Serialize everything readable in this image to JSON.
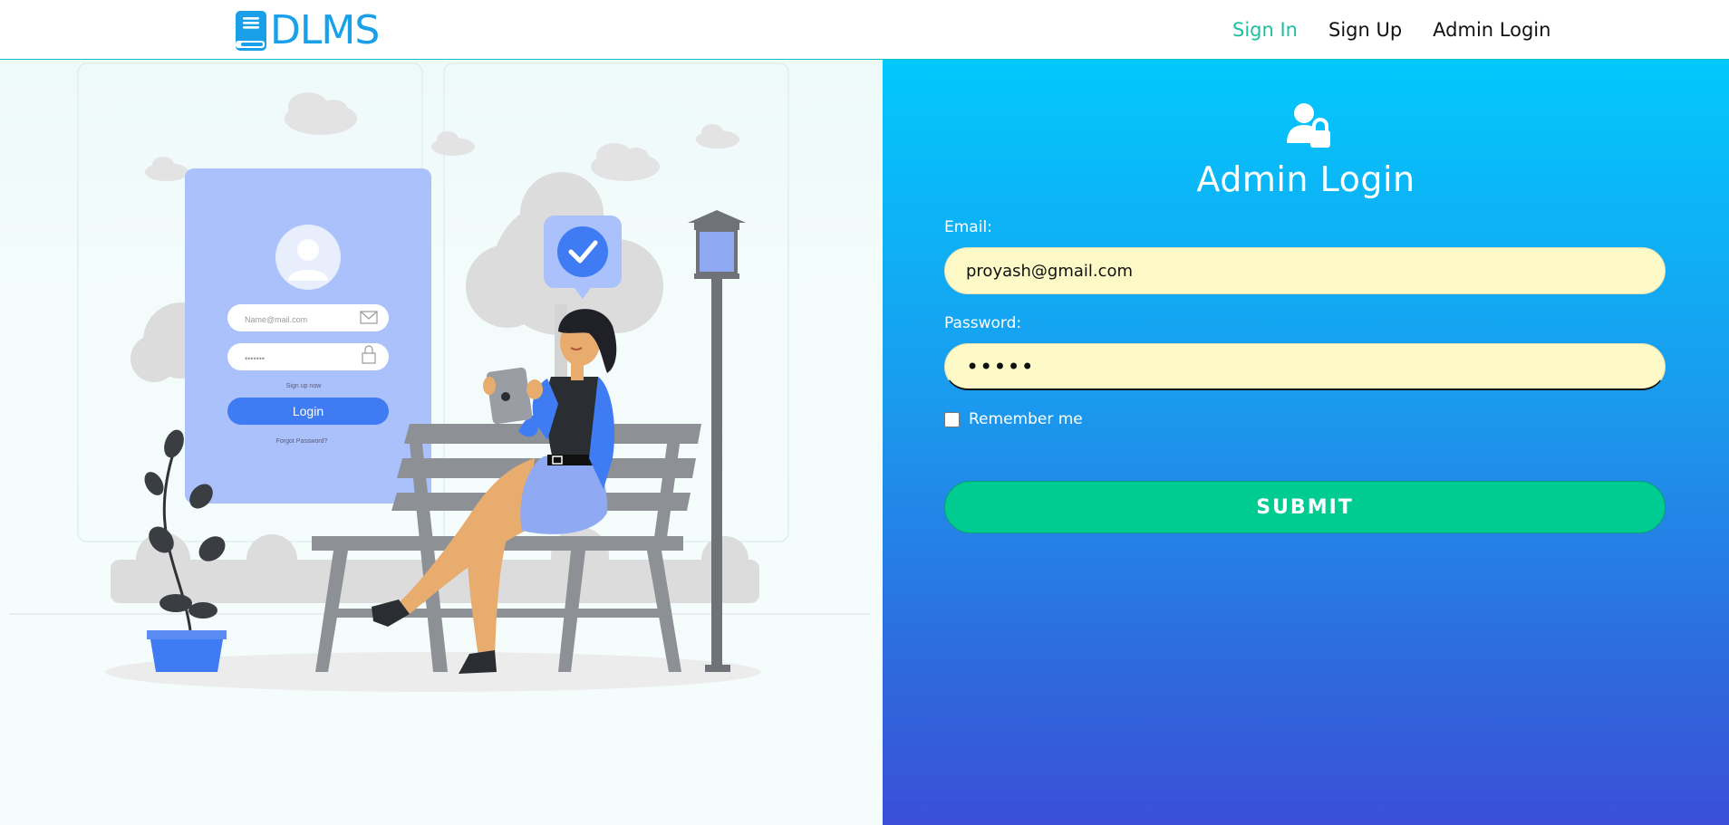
{
  "brand": {
    "name": "DLMS",
    "icon": "book-icon",
    "color": "#1aa0e8"
  },
  "nav": {
    "items": [
      {
        "label": "Sign In",
        "active": true
      },
      {
        "label": "Sign Up",
        "active": false
      },
      {
        "label": "Admin Login",
        "active": false
      }
    ],
    "active_color": "#1dbfa0"
  },
  "illustration": {
    "card": {
      "email_placeholder": "Name@mail.com",
      "password_placeholder": "•••••••",
      "signup_link": "Sign up now",
      "login_button": "Login",
      "forgot_link": "Forgot Password?"
    }
  },
  "login": {
    "icon": "user-lock-icon",
    "title": "Admin Login",
    "email_label": "Email:",
    "email_value": "proyash@gmail.com",
    "password_label": "Password:",
    "password_value": "proya",
    "remember_label": "Remember me",
    "remember_checked": false,
    "submit_label": "SUBMIT",
    "submit_color": "#00cc92",
    "input_bg": "#fefac8"
  }
}
